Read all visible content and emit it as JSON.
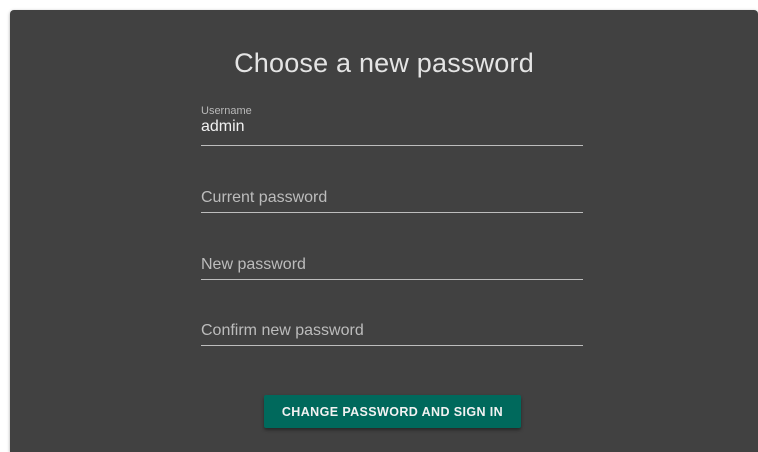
{
  "form": {
    "title": "Choose a new password",
    "username": {
      "label": "Username",
      "value": "admin"
    },
    "current_password": {
      "placeholder": "Current password"
    },
    "new_password": {
      "placeholder": "New password"
    },
    "confirm_password": {
      "placeholder": "Confirm new password"
    },
    "submit_label": "CHANGE PASSWORD AND SIGN IN"
  },
  "colors": {
    "card_background": "#414141",
    "button_background": "#00695c",
    "underline": "#bdbdbd"
  }
}
